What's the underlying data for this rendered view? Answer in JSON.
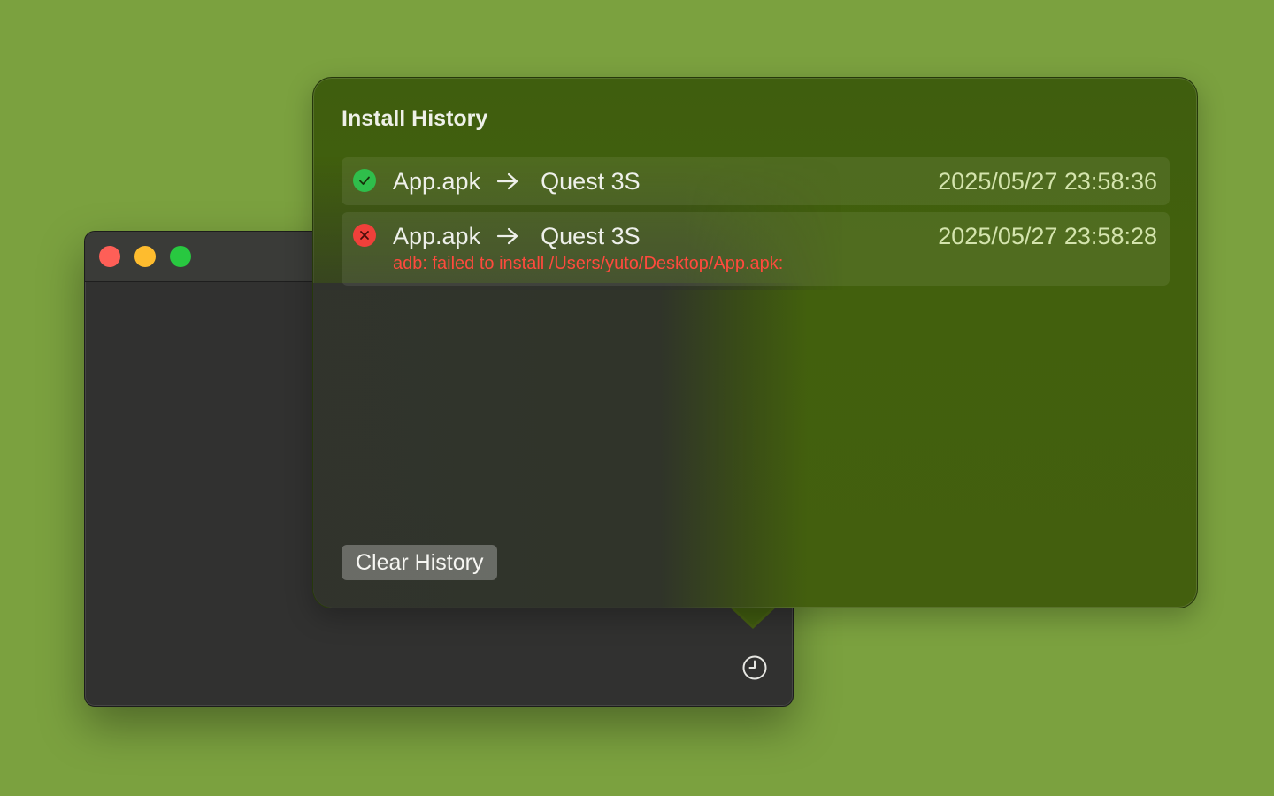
{
  "colors": {
    "desktop_background": "#7ba13f",
    "success": "#2fbe4b",
    "error": "#f0403a",
    "error_text": "#ff4a3d",
    "timestamp_text": "#d4e4ad"
  },
  "app_window": {
    "traffic_lights": [
      "close",
      "minimize",
      "zoom"
    ],
    "history_button_icon": "clock-icon"
  },
  "popover": {
    "title": "Install History",
    "entries": [
      {
        "status": "success",
        "status_icon": "checkmark-icon",
        "file": "App.apk",
        "arrow_icon": "arrow-right-icon",
        "device": "Quest 3S",
        "timestamp": "2025/05/27 23:58:36",
        "error": ""
      },
      {
        "status": "failed",
        "status_icon": "x-mark-icon",
        "file": "App.apk",
        "arrow_icon": "arrow-right-icon",
        "device": "Quest 3S",
        "timestamp": "2025/05/27 23:58:28",
        "error": "adb: failed to install /Users/yuto/Desktop/App.apk:"
      }
    ],
    "clear_button_label": "Clear History"
  }
}
